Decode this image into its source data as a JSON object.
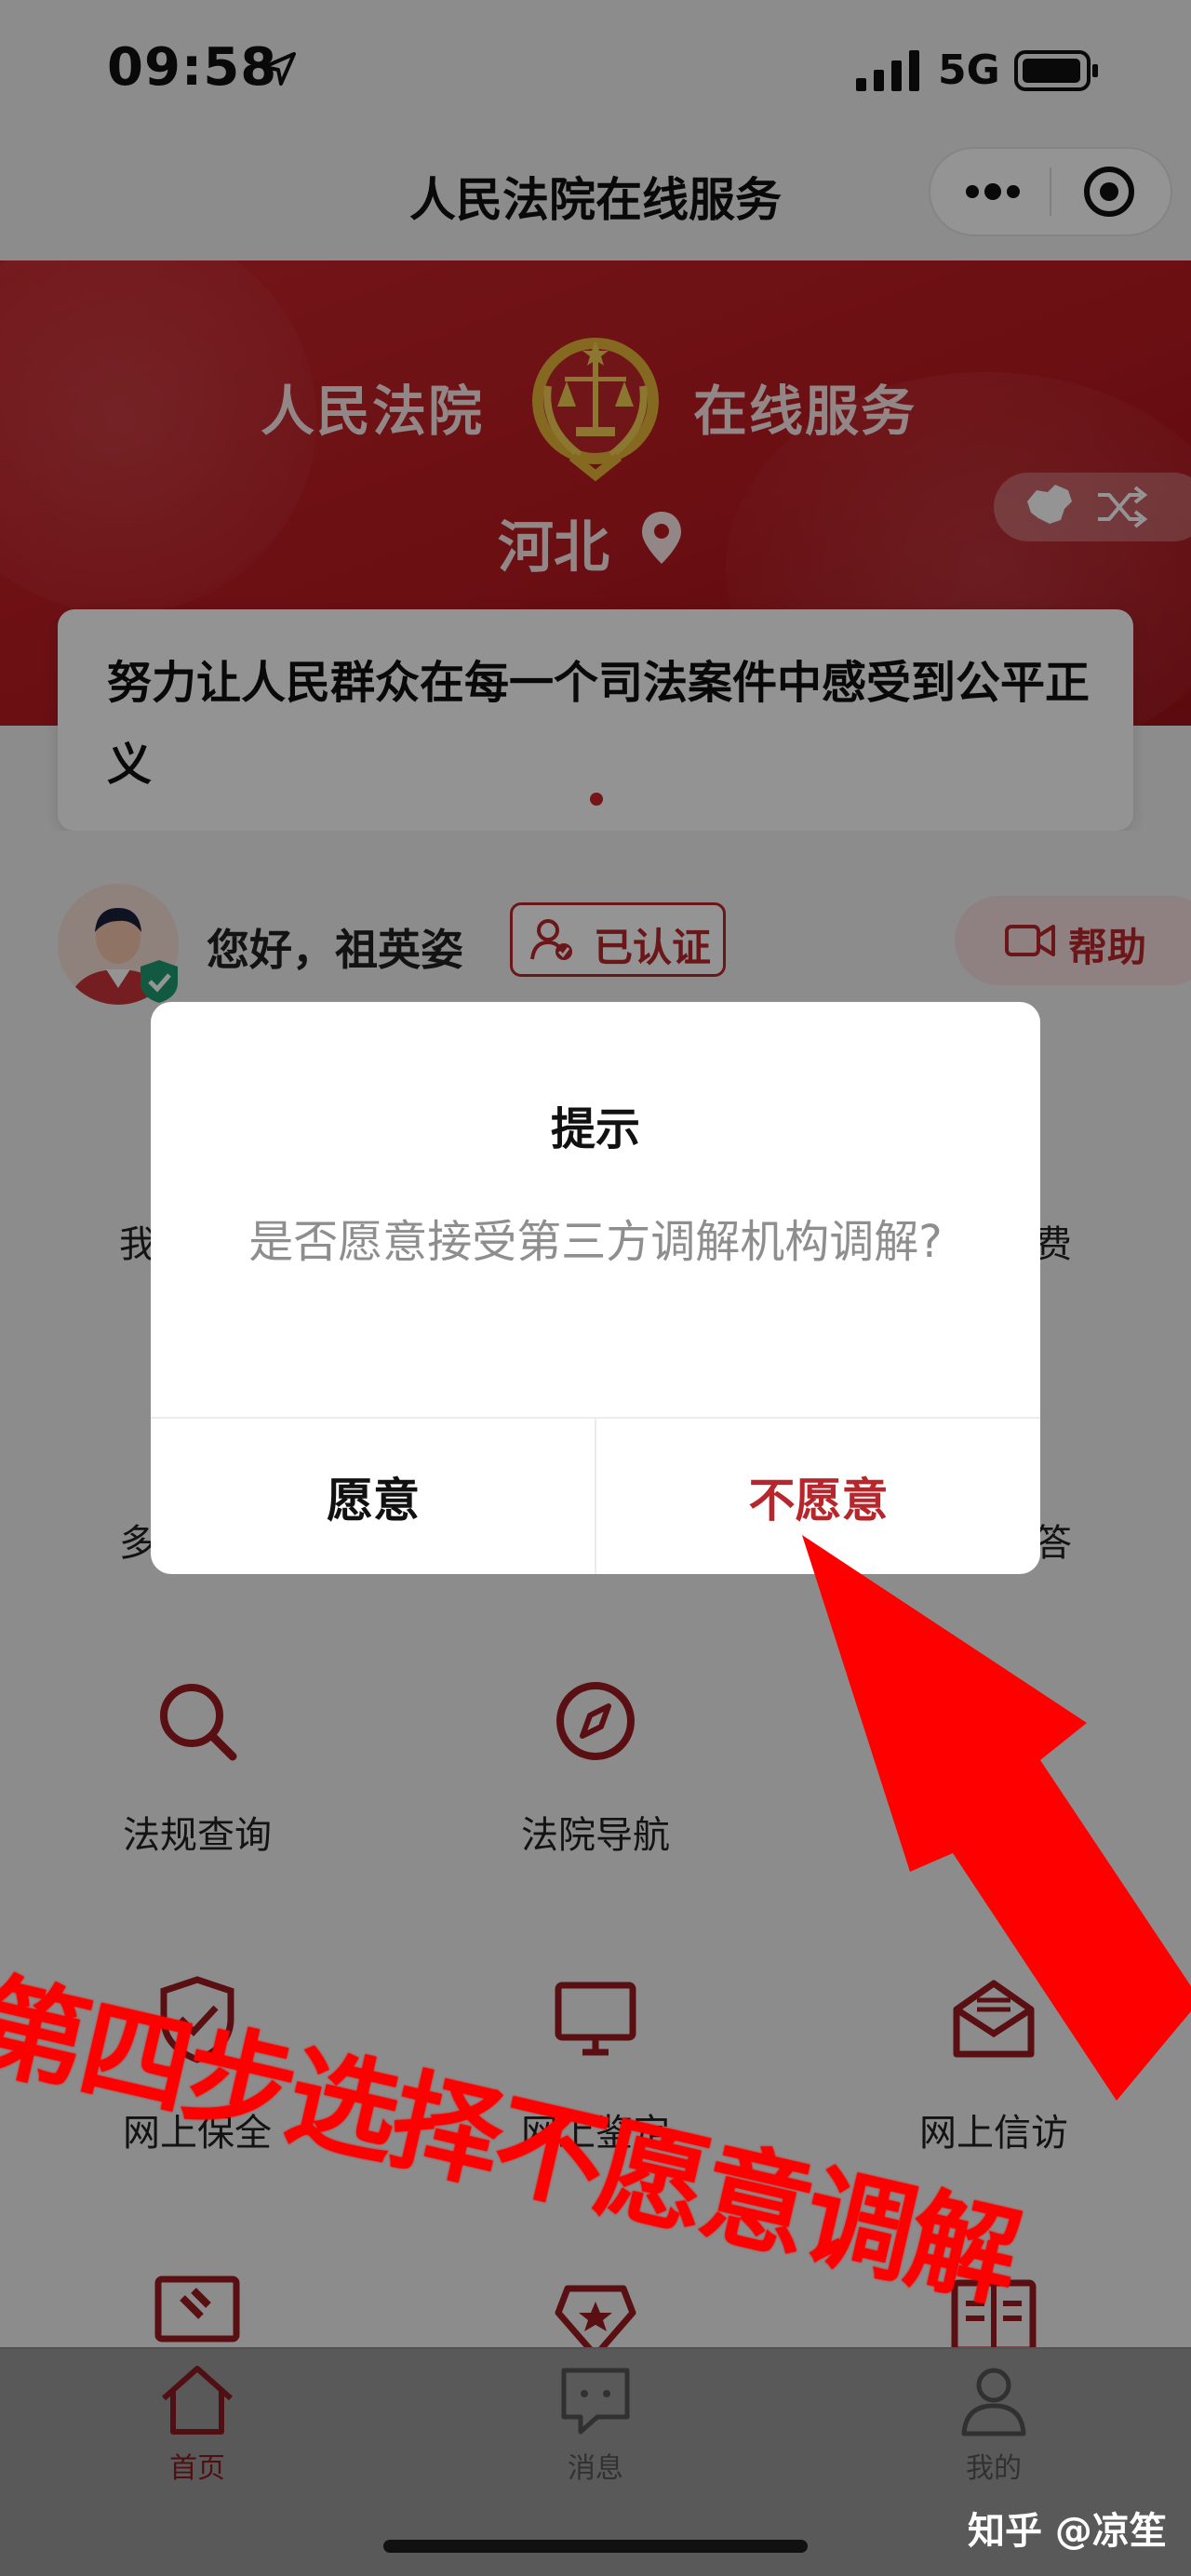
{
  "status_bar": {
    "time": "09:58",
    "network": "5G"
  },
  "title_bar": {
    "title": "人民法院在线服务"
  },
  "banner": {
    "left_text": "人民法院",
    "right_text": "在线服务",
    "province": "河北"
  },
  "notice": {
    "text": "努力让人民群众在每一个司法案件中感受到公平正义"
  },
  "user": {
    "greeting": "您好，祖英姿",
    "auth_status": "已认证",
    "help_label": "帮助"
  },
  "partial_labels": {
    "row1_left": "我",
    "row1_right": "费",
    "row2_left": "多",
    "row2_right": "答"
  },
  "grid": [
    {
      "label": "法规查询",
      "icon": "search-icon"
    },
    {
      "label": "法院导航",
      "icon": "compass-icon"
    },
    {
      "label": "网上保全",
      "icon": "shield-check-icon"
    },
    {
      "label": "网上鉴定",
      "icon": "monitor-icon"
    },
    {
      "label": "网上信访",
      "icon": "envelope-icon"
    }
  ],
  "dialog": {
    "title": "提示",
    "message": "是否愿意接受第三方调解机构调解?",
    "confirm": "愿意",
    "cancel": "不愿意"
  },
  "tabbar": {
    "items": [
      {
        "label": "首页",
        "icon": "home-icon",
        "active": true
      },
      {
        "label": "消息",
        "icon": "message-icon",
        "active": false
      },
      {
        "label": "我的",
        "icon": "user-icon",
        "active": false
      }
    ]
  },
  "annotation": {
    "text": "第四步选择不愿意调解"
  },
  "watermark": "知乎 @凉笙",
  "colors": {
    "brand_red": "#c8262c",
    "accent_red": "#b8262b",
    "annotation_red": "#ff0000"
  }
}
